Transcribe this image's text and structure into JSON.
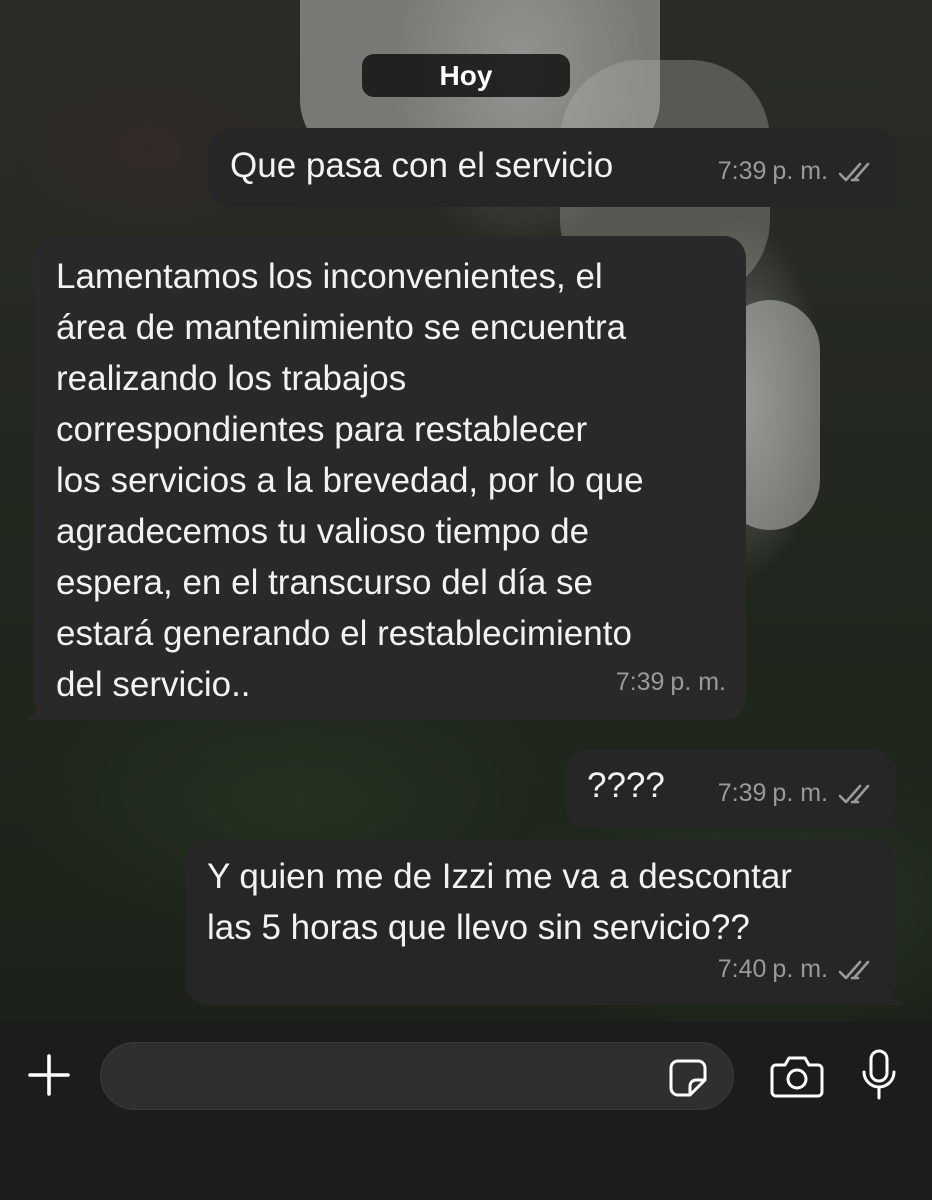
{
  "chat": {
    "date_divider": "Hoy",
    "messages": [
      {
        "direction": "outgoing",
        "lines": [
          "Que pasa con el servicio"
        ],
        "time": "7:39",
        "ampm": "p. m.",
        "status": "read"
      },
      {
        "direction": "incoming",
        "lines": [
          "Lamentamos los inconvenientes, el",
          "área de mantenimiento se encuentra",
          "realizando los trabajos",
          "correspondientes para restablecer",
          "los servicios a la brevedad, por lo que",
          "agradecemos tu valioso tiempo de",
          "espera, en el transcurso del día se",
          "estará generando el restablecimiento",
          "del servicio.."
        ],
        "time": "7:39",
        "ampm": "p. m."
      },
      {
        "direction": "outgoing",
        "lines": [
          "????"
        ],
        "time": "7:39",
        "ampm": "p. m.",
        "status": "read"
      },
      {
        "direction": "outgoing",
        "lines": [
          "Y quien me de Izzi me va a descontar",
          "las 5 horas que llevo sin servicio??"
        ],
        "time": "7:40",
        "ampm": "p. m.",
        "status": "read"
      }
    ]
  },
  "composer": {
    "input_value": "",
    "icons": [
      "plus-icon",
      "sticker-icon",
      "camera-icon",
      "microphone-icon"
    ]
  },
  "colors": {
    "bubble": "#292929",
    "meta_text": "#9a9a9a",
    "composer_bg": "#1c1c1e"
  }
}
